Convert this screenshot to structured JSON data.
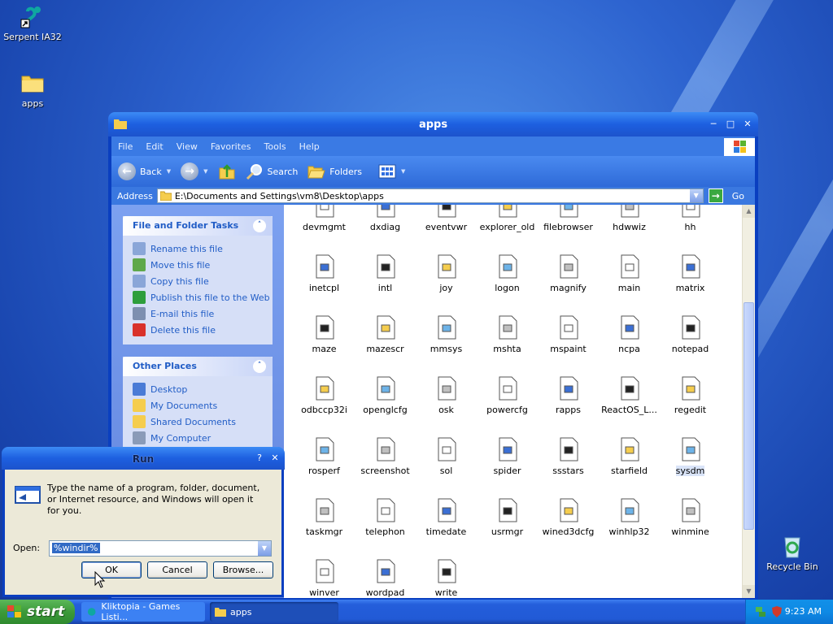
{
  "desktop": {
    "icons": [
      {
        "label": "Serpent IA32",
        "icon": "serpent-icon"
      },
      {
        "label": "apps",
        "icon": "folder-icon"
      },
      {
        "label": "Recycle Bin",
        "icon": "recycle-bin-icon"
      }
    ]
  },
  "explorer": {
    "title": "apps",
    "menu": [
      "File",
      "Edit",
      "View",
      "Favorites",
      "Tools",
      "Help"
    ],
    "toolbar": {
      "back": "Back",
      "search": "Search",
      "folders": "Folders"
    },
    "address": {
      "label": "Address",
      "path": "E:\\Documents and Settings\\vm8\\Desktop\\apps",
      "go": "Go"
    },
    "tasks": {
      "title": "File and Folder Tasks",
      "items": [
        {
          "label": "Rename this file",
          "icon": "rename-icon"
        },
        {
          "label": "Move this file",
          "icon": "move-icon"
        },
        {
          "label": "Copy this file",
          "icon": "copy-icon"
        },
        {
          "label": "Publish this file to the Web",
          "icon": "globe-icon"
        },
        {
          "label": "E-mail this file",
          "icon": "email-icon"
        },
        {
          "label": "Delete this file",
          "icon": "delete-icon"
        }
      ]
    },
    "places": {
      "title": "Other Places",
      "items": [
        {
          "label": "Desktop",
          "icon": "desktop-icon"
        },
        {
          "label": "My Documents",
          "icon": "documents-icon"
        },
        {
          "label": "Shared Documents",
          "icon": "folder-icon"
        },
        {
          "label": "My Computer",
          "icon": "computer-icon"
        }
      ]
    },
    "files": [
      "devmgmt",
      "dxdiag",
      "eventvwr",
      "explorer_old",
      "filebrowser",
      "hdwwiz",
      "hh",
      "inetcpl",
      "intl",
      "joy",
      "logon",
      "magnify",
      "main",
      "matrix",
      "maze",
      "mazescr",
      "mmsys",
      "mshta",
      "mspaint",
      "ncpa",
      "notepad",
      "odbccp32i",
      "openglcfg",
      "osk",
      "powercfg",
      "rapps",
      "ReactOS_L...",
      "regedit",
      "rosperf",
      "screenshot",
      "sol",
      "spider",
      "ssstars",
      "starfield",
      "sysdm",
      "taskmgr",
      "telephon",
      "timedate",
      "usrmgr",
      "wined3dcfg",
      "winhlp32",
      "winmine",
      "winver",
      "wordpad",
      "write"
    ],
    "selected_file": "sysdm"
  },
  "run": {
    "title": "Run",
    "description": "Type the name of a program, folder, document, or Internet resource, and Windows will open it for you.",
    "open_label": "Open:",
    "open_value": "%windir%",
    "ok": "OK",
    "cancel": "Cancel",
    "browse": "Browse..."
  },
  "taskbar": {
    "start": "start",
    "items": [
      "Kliktopia - Games Listi...",
      "apps"
    ],
    "clock": "9:23 AM"
  }
}
